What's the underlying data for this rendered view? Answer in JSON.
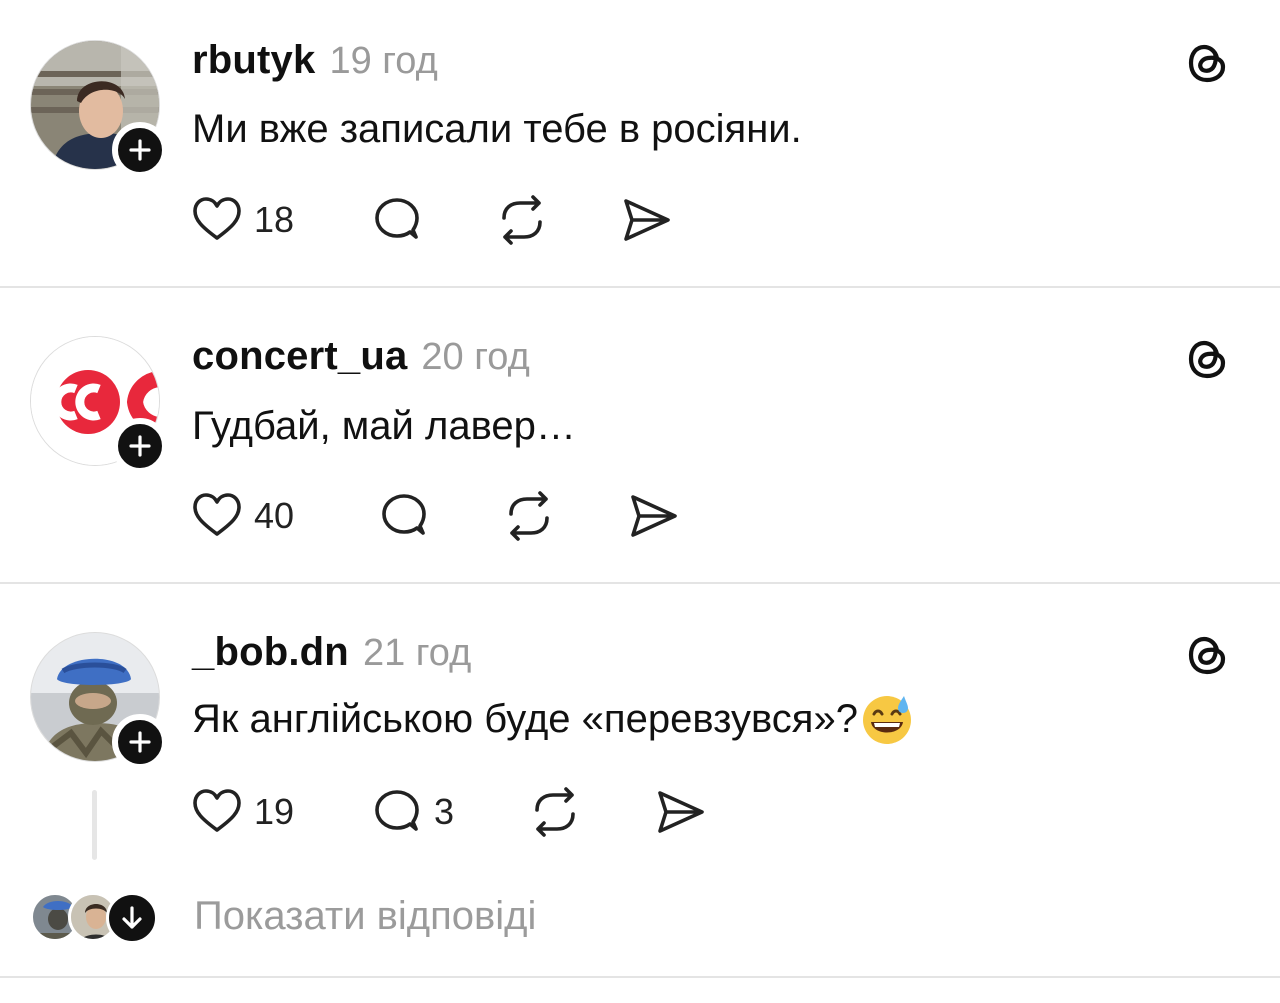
{
  "posts": [
    {
      "username": "rbutyk",
      "time": "19 год",
      "text": "Ми вже записали тебе в росіяни.",
      "likes": "18",
      "replies": "",
      "avatar": "photo-man"
    },
    {
      "username": "concert_ua",
      "time": "20 год",
      "text": "Гудбай, май лавер…",
      "likes": "40",
      "replies": "",
      "avatar": "concert-logo"
    },
    {
      "username": "_bob.dn",
      "time": "21 год",
      "text": "Як англійською буде «перевзувся»?",
      "emoji": "grinning-face-with-sweat",
      "likes": "19",
      "replies": "3",
      "avatar": "photo-soldier"
    }
  ],
  "replies_preview": {
    "label": "Показати відповіді",
    "icon": "arrow-down-icon"
  },
  "icons": {
    "like": "heart-icon",
    "reply": "comment-icon",
    "repost": "repost-icon",
    "share": "send-icon",
    "platform": "threads-logo-icon",
    "follow": "plus-icon"
  },
  "colors": {
    "text": "#111111",
    "muted": "#9a9a9a",
    "divider": "#e4e4e4",
    "logo_red": "#e8283c"
  }
}
